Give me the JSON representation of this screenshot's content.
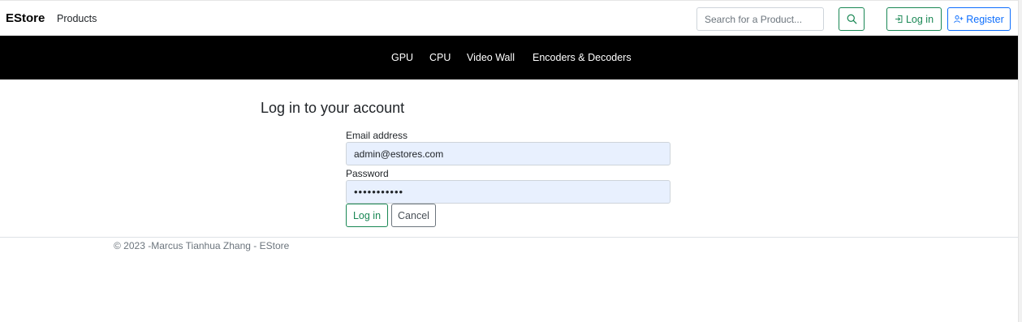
{
  "navbar": {
    "brand": "EStore",
    "products_link": "Products",
    "search_placeholder": "Search for a Product...",
    "search_icon": "search-icon",
    "login_label": "Log in",
    "login_icon": "login-arrow-icon",
    "register_label": "Register",
    "register_icon": "person-plus-icon"
  },
  "categories": [
    "GPU",
    "CPU",
    "Video Wall",
    "Encoders & Decoders"
  ],
  "login_form": {
    "title": "Log in to your account",
    "email_label": "Email address",
    "email_value": "admin@estores.com",
    "password_label": "Password",
    "password_value": "•••••••••••",
    "submit_label": "Log in",
    "cancel_label": "Cancel"
  },
  "footer": {
    "text": "© 2023 -Marcus Tianhua Zhang - EStore"
  },
  "colors": {
    "success": "#198754",
    "primary": "#0d6efd",
    "category_bar": "#000000",
    "autofill_background": "#e8f0fe"
  }
}
